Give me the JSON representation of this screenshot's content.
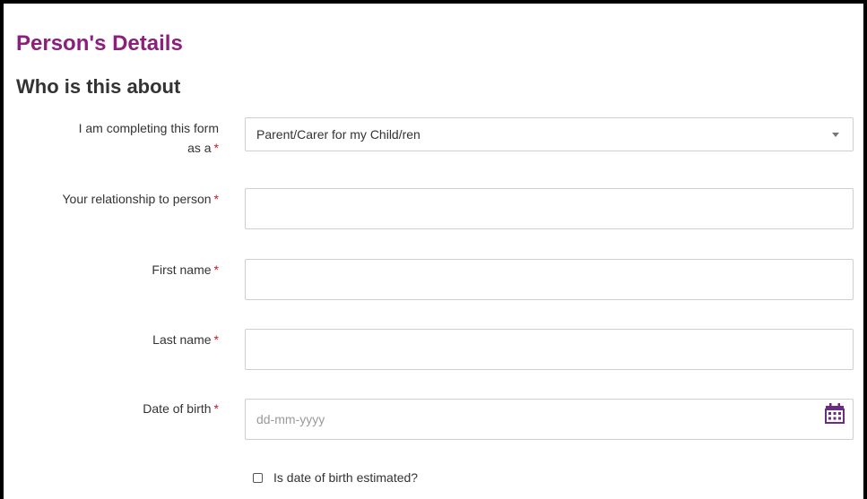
{
  "page": {
    "title": "Person's Details",
    "section_title": "Who is this about"
  },
  "colors": {
    "title": "#8a1f7d",
    "required": "#c0182b",
    "calendar_icon": "#6b2c82",
    "border": "#cfcfcf"
  },
  "form": {
    "required_marker": "*",
    "completing_as": {
      "label_line1": "I am completing this form",
      "label_line2": "as a",
      "value": "Parent/Carer for my Child/ren"
    },
    "relationship": {
      "label": "Your relationship to person",
      "value": ""
    },
    "first_name": {
      "label": "First name",
      "value": ""
    },
    "last_name": {
      "label": "Last name",
      "value": ""
    },
    "date_of_birth": {
      "label": "Date of birth",
      "value": "",
      "placeholder": "dd-mm-yyyy",
      "icon": "calendar-icon"
    },
    "dob_estimated": {
      "label": "Is date of birth estimated?",
      "checked": false
    }
  }
}
